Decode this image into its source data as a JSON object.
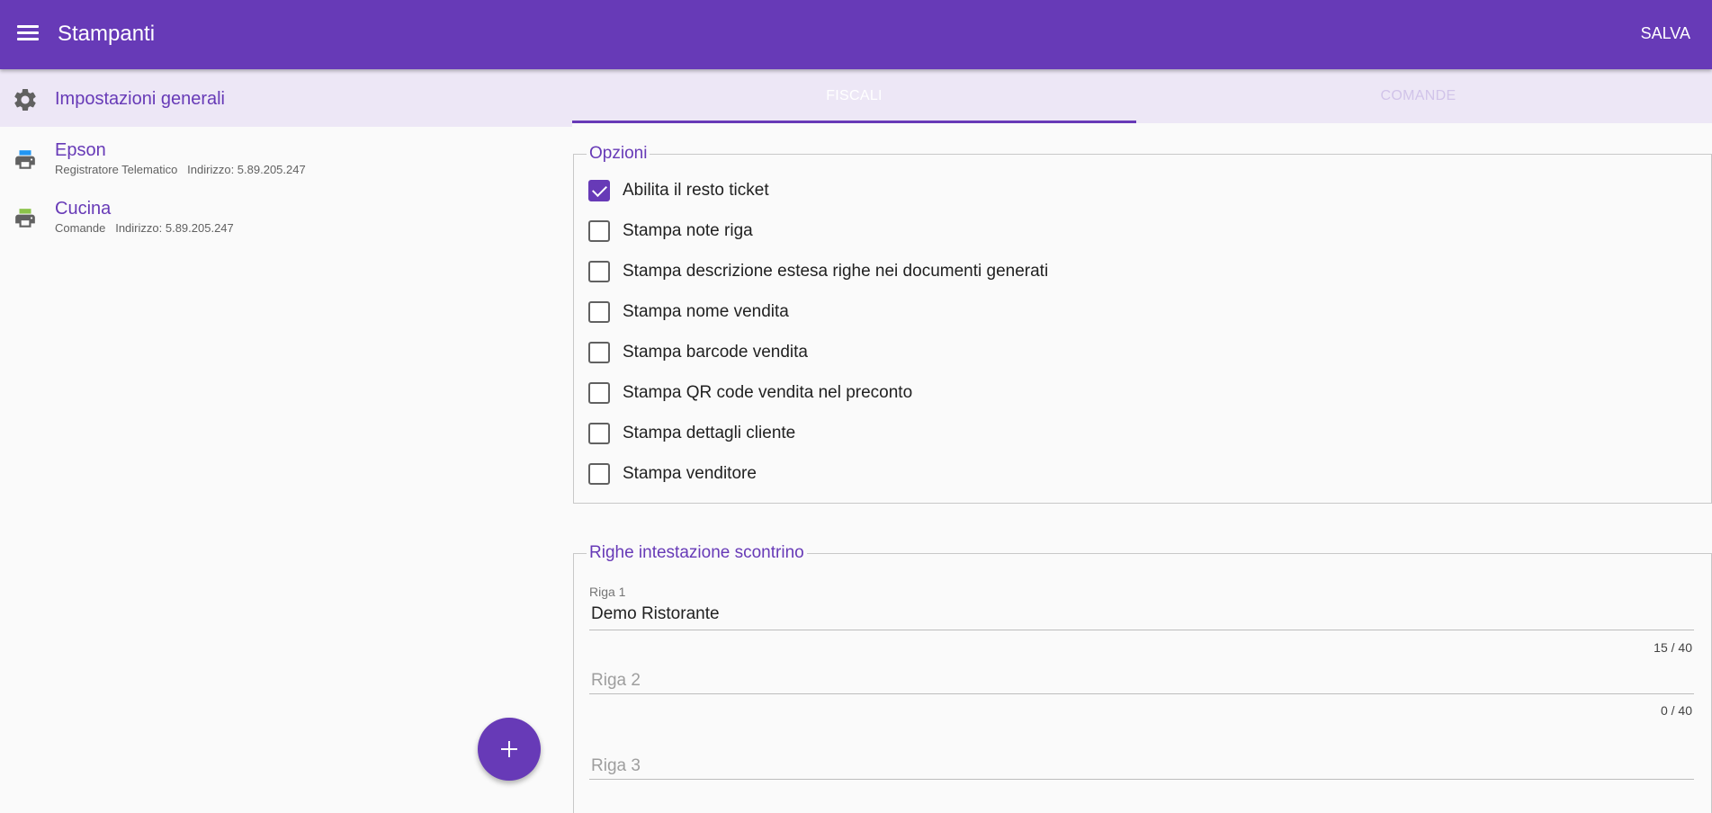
{
  "appbar": {
    "title": "Stampanti",
    "save_label": "SALVA",
    "bg_color": "#673ab7"
  },
  "sidebar": {
    "general": {
      "label": "Impostazioni generali",
      "icon": "gear-icon"
    },
    "printers": [
      {
        "name": "Epson",
        "type": "Registratore Telematico",
        "address": "Indirizzo: 5.89.205.247",
        "icon": "printer-icon",
        "icon_accent": "#2196f3"
      },
      {
        "name": "Cucina",
        "type": "Comande",
        "address": "Indirizzo: 5.89.205.247",
        "icon": "printer-icon",
        "icon_accent": "#8bc34a"
      }
    ],
    "fab_icon": "plus-icon"
  },
  "tabs": [
    {
      "label": "FISCALI",
      "active": true
    },
    {
      "label": "COMANDE",
      "active": false
    }
  ],
  "options": {
    "legend": "Opzioni",
    "items": [
      {
        "label": "Abilita il resto ticket",
        "checked": true
      },
      {
        "label": "Stampa note riga",
        "checked": false
      },
      {
        "label": "Stampa descrizione estesa righe nei documenti generati",
        "checked": false
      },
      {
        "label": "Stampa nome vendita",
        "checked": false
      },
      {
        "label": "Stampa barcode vendita",
        "checked": false
      },
      {
        "label": "Stampa QR code vendita nel preconto",
        "checked": false
      },
      {
        "label": "Stampa dettagli cliente",
        "checked": false
      },
      {
        "label": "Stampa venditore",
        "checked": false
      }
    ]
  },
  "header_lines": {
    "legend": "Righe intestazione scontrino",
    "fields": [
      {
        "label": "Riga 1",
        "value": "Demo Ristorante",
        "counter": "15 / 40"
      },
      {
        "label": "Riga 2",
        "value": "",
        "counter": "0 / 40"
      },
      {
        "label": "Riga 3",
        "value": "",
        "counter": ""
      }
    ]
  }
}
